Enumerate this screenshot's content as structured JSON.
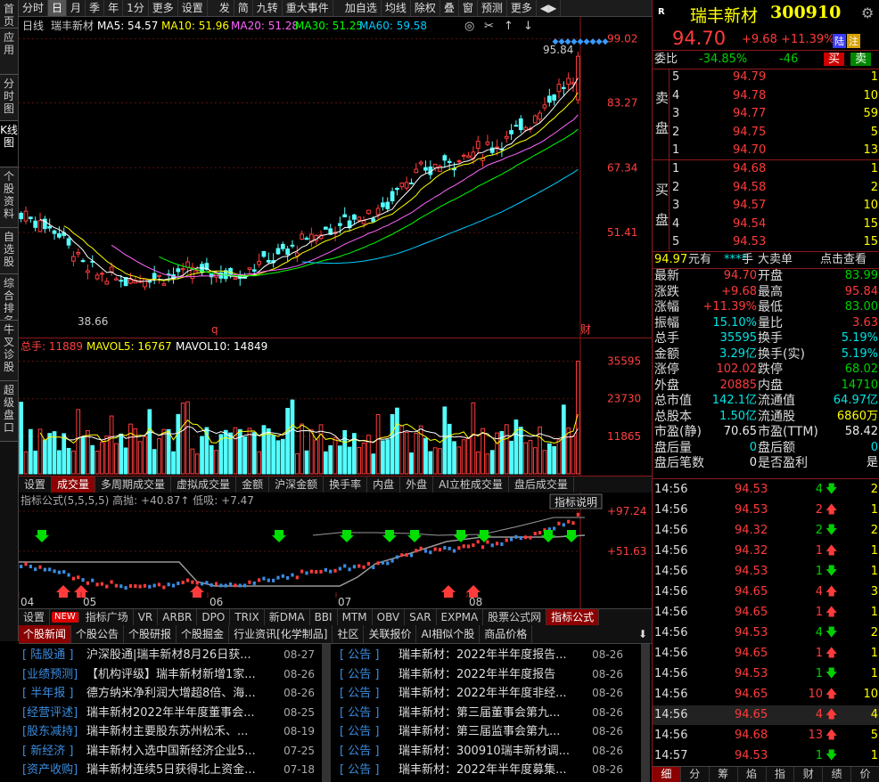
{
  "vertical_tabs": [
    "首页",
    "应用",
    "分时图",
    "K线图",
    "个股资料",
    "自选股",
    "综合排名",
    "牛叉诊股",
    "超级盘口"
  ],
  "vertical_active": 3,
  "topbar": [
    "分时",
    "日",
    "月",
    "季",
    "年",
    "1分",
    "更多",
    "设置",
    "",
    "发",
    "简",
    "九转",
    "重大事件",
    "",
    "加自选",
    "均线",
    "除权",
    "叠",
    "窗",
    "预测",
    "更多"
  ],
  "topbar_active": 1,
  "kchart": {
    "period": "日线",
    "name": "瑞丰新材",
    "ma5": "MA5: 54.57",
    "ma10": "MA10: 51.96",
    "ma20": "MA20: 51.28",
    "ma30": "MA30: 51.25",
    "ma60": "MA60: 59.58",
    "yticks": [
      "99.02",
      "83.27",
      "67.34",
      "51.41"
    ],
    "high_label": "95.84",
    "low_label": "38.66",
    "marker_q": "q",
    "marker_cai": "财",
    "ymin": 30,
    "ymax": 100
  },
  "volchart": {
    "label": "总手: 11889",
    "mavol5": "MAVOL5: 16767",
    "mavol10": "MAVOL10: 14849",
    "yticks": [
      "35595",
      "23730",
      "11865"
    ],
    "vmax": 38000
  },
  "voltabs": [
    "设置",
    "成交量",
    "多周期成交量",
    "虚拟成交量",
    "金额",
    "沪深金额",
    "换手率",
    "内盘",
    "外盘",
    "AI立桩成交量",
    "盘后成交量"
  ],
  "voltabs_active": 1,
  "indchart": {
    "label": "指标公式(5,5,5,5) 高抛: +40.87↑ 低吸: +7.47",
    "explain": "指标说明",
    "yticks": [
      "+97.24",
      "+51.63"
    ],
    "months": [
      "04",
      "05",
      "06",
      "07",
      "08"
    ]
  },
  "indtabs": [
    "设置",
    "NEW",
    "指标广场",
    "VR",
    "ARBR",
    "DPO",
    "TRIX",
    "新DMA",
    "BBI",
    "MTM",
    "OBV",
    "SAR",
    "EXPMA",
    "股票公式网",
    "指标公式"
  ],
  "indtabs_active": 14,
  "newstabs": [
    "个股新闻",
    "个股公告",
    "个股研报",
    "个股掘金",
    "行业资讯[化学制品]",
    "社区",
    "关联报价",
    "AI相似个股",
    "商品价格"
  ],
  "newstabs_active": 0,
  "news_left": [
    {
      "tag": "[ 陆股通 ]",
      "title": "沪深股通|瑞丰新材8月26日获...",
      "date": "08-27"
    },
    {
      "tag": "[业绩预测]",
      "title": "【机构评级】瑞丰新材新增1家...",
      "date": "08-26"
    },
    {
      "tag": "[ 半年报 ]",
      "title": "德方纳米净利润大增超8倍、海...",
      "date": "08-26"
    },
    {
      "tag": "[经营评述]",
      "title": "瑞丰新材2022年半年度董事会...",
      "date": "08-25"
    },
    {
      "tag": "[股东减持]",
      "title": "瑞丰新材主要股东苏州松禾、...",
      "date": "08-19"
    },
    {
      "tag": "[ 新经济 ]",
      "title": "瑞丰新材入选中国新经济企业5...",
      "date": "07-25"
    },
    {
      "tag": "[资产收购]",
      "title": "瑞丰新材连续5日获得北上资金...",
      "date": "07-18"
    }
  ],
  "news_right": [
    {
      "tag": "[   公告   ]",
      "title": "瑞丰新材：2022年半年度报告...",
      "date": "08-26"
    },
    {
      "tag": "[   公告   ]",
      "title": "瑞丰新材：2022年半年度报告",
      "date": "08-26"
    },
    {
      "tag": "[   公告   ]",
      "title": "瑞丰新材：2022年半年度非经...",
      "date": "08-26"
    },
    {
      "tag": "[   公告   ]",
      "title": "瑞丰新材：第三届董事会第九...",
      "date": "08-26"
    },
    {
      "tag": "[   公告   ]",
      "title": "瑞丰新材：第三届监事会第九...",
      "date": "08-26"
    },
    {
      "tag": "[   公告   ]",
      "title": "瑞丰新材：300910瑞丰新材调...",
      "date": "08-26"
    },
    {
      "tag": "[   公告   ]",
      "title": "瑞丰新材：2022年半年度募集...",
      "date": "08-26"
    }
  ],
  "quote": {
    "r_badge": "R",
    "name": "瑞丰新材",
    "code": "300910",
    "price": "94.70",
    "change": "+9.68",
    "pct": "+11.39%",
    "tag1": "陆",
    "tag2": "注",
    "weibi_label": "委比",
    "weibi": "-34.85%",
    "weicha": "-46",
    "buy": "买",
    "sell": "卖"
  },
  "sell_side_label": [
    "卖",
    "盘"
  ],
  "asks": [
    {
      "lvl": "5",
      "price": "94.79",
      "vol": "1"
    },
    {
      "lvl": "4",
      "price": "94.78",
      "vol": "10"
    },
    {
      "lvl": "3",
      "price": "94.77",
      "vol": "59"
    },
    {
      "lvl": "2",
      "price": "94.75",
      "vol": "5"
    },
    {
      "lvl": "1",
      "price": "94.70",
      "vol": "13"
    }
  ],
  "buy_side_label": [
    "买",
    "盘"
  ],
  "bids": [
    {
      "lvl": "1",
      "price": "94.68",
      "vol": "1"
    },
    {
      "lvl": "2",
      "price": "94.58",
      "vol": "2"
    },
    {
      "lvl": "3",
      "price": "94.57",
      "vol": "10"
    },
    {
      "lvl": "4",
      "price": "94.54",
      "vol": "15"
    },
    {
      "lvl": "5",
      "price": "94.53",
      "vol": "15"
    }
  ],
  "bigorder": {
    "price": "94.97",
    "unit": "元有",
    "stars": "****",
    "hand": "手",
    "label": "大卖单",
    "link": "点击查看"
  },
  "stats": [
    [
      "最新",
      "94.70",
      "red",
      "开盘",
      "83.99",
      "green"
    ],
    [
      "涨跌",
      "+9.68",
      "red",
      "最高",
      "95.84",
      "red"
    ],
    [
      "涨幅",
      "+11.39%",
      "red",
      "最低",
      "83.00",
      "green"
    ],
    [
      "振幅",
      "15.10%",
      "cyan",
      "量比",
      "3.63",
      "red"
    ],
    [
      "总手",
      "35595",
      "cyan",
      "换手",
      "5.19%",
      "cyan"
    ],
    [
      "金额",
      "3.29亿",
      "cyan",
      "换手(实)",
      "5.19%",
      "cyan"
    ],
    [
      "涨停",
      "102.02",
      "red",
      "跌停",
      "68.02",
      "green"
    ],
    [
      "外盘",
      "20885",
      "red",
      "内盘",
      "14710",
      "green"
    ],
    [
      "总市值",
      "142.1亿",
      "cyan",
      "流通值",
      "64.97亿",
      "cyan"
    ],
    [
      "总股本",
      "1.50亿",
      "cyan",
      "流通股",
      "6860万",
      "yellow"
    ],
    [
      "市盈(静)",
      "70.65",
      "white",
      "市盈(TTM)",
      "58.42",
      "white"
    ],
    [
      "盘后量",
      "0",
      "cyan",
      "盘后额",
      "0",
      "cyan"
    ],
    [
      "盘后笔数",
      "0",
      "white",
      "是否盈利",
      "是",
      "white"
    ]
  ],
  "ticks": [
    {
      "t": "14:56",
      "p": "94.53",
      "v": "4",
      "d": "down",
      "n": "2"
    },
    {
      "t": "14:56",
      "p": "94.53",
      "v": "2",
      "d": "up",
      "n": "1"
    },
    {
      "t": "14:56",
      "p": "94.32",
      "v": "2",
      "d": "down",
      "n": "2"
    },
    {
      "t": "14:56",
      "p": "94.32",
      "v": "1",
      "d": "up",
      "n": "1"
    },
    {
      "t": "14:56",
      "p": "94.53",
      "v": "1",
      "d": "down",
      "n": "1"
    },
    {
      "t": "14:56",
      "p": "94.65",
      "v": "4",
      "d": "up",
      "n": "3"
    },
    {
      "t": "14:56",
      "p": "94.65",
      "v": "1",
      "d": "up",
      "n": "1"
    },
    {
      "t": "14:56",
      "p": "94.53",
      "v": "4",
      "d": "down",
      "n": "2"
    },
    {
      "t": "14:56",
      "p": "94.65",
      "v": "1",
      "d": "up",
      "n": "1"
    },
    {
      "t": "14:56",
      "p": "94.53",
      "v": "1",
      "d": "down",
      "n": "1"
    },
    {
      "t": "14:56",
      "p": "94.65",
      "v": "10",
      "d": "up",
      "n": "10"
    },
    {
      "t": "14:56",
      "p": "94.65",
      "v": "4",
      "d": "up",
      "n": "4"
    },
    {
      "t": "14:56",
      "p": "94.68",
      "v": "13",
      "d": "up",
      "n": "5"
    },
    {
      "t": "14:57",
      "p": "94.53",
      "v": "1",
      "d": "down",
      "n": "1"
    }
  ],
  "tick_highlight": 11,
  "rtabs": [
    "细",
    "分",
    "筹",
    "焰",
    "指",
    "财",
    "绩",
    "价"
  ],
  "rtabs_active": 0
}
